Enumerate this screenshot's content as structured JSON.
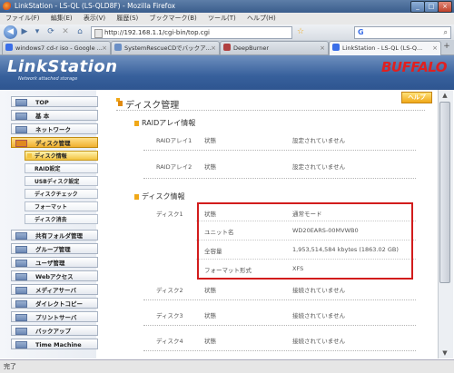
{
  "window": {
    "title": "LinkStation - LS-QL (LS-QLD8F) - Mozilla Firefox"
  },
  "menu": [
    "ファイル(F)",
    "編集(E)",
    "表示(V)",
    "履歴(S)",
    "ブックマーク(B)",
    "ツール(T)",
    "ヘルプ(H)"
  ],
  "address": {
    "url": "http://192.168.1.1/cgi-bin/top.cgi"
  },
  "tabs": [
    {
      "label": "windows7 cd-r iso - Google ...",
      "color": "#3a6ee8"
    },
    {
      "label": "SystemRescueCDでバックア...",
      "color": "#6a8fc6"
    },
    {
      "label": "DeepBurner",
      "color": "#b04040"
    },
    {
      "label": "LinkStation - LS-QL (LS-Q...",
      "color": "#3a6ee8"
    }
  ],
  "header": {
    "logo": "LinkStation",
    "logo_sub": "Network attached storage",
    "brand": "BUFFALO",
    "brand_color": "#e02020"
  },
  "sidebar": {
    "items": [
      {
        "label": "TOP"
      },
      {
        "label": "基 本"
      },
      {
        "label": "ネットワーク"
      },
      {
        "label": "ディスク管理"
      },
      {
        "label": "共有フォルダ管理"
      },
      {
        "label": "グループ管理"
      },
      {
        "label": "ユーザ管理"
      },
      {
        "label": "Webアクセス"
      },
      {
        "label": "メディアサーバ"
      },
      {
        "label": "ダイレクトコピー"
      },
      {
        "label": "プリントサーバ"
      },
      {
        "label": "バックアップ"
      },
      {
        "label": "Time Machine"
      }
    ],
    "subitems": [
      {
        "label": "ディスク情報"
      },
      {
        "label": "RAID設定"
      },
      {
        "label": "USBディスク設定"
      },
      {
        "label": "ディスクチェック"
      },
      {
        "label": "フォーマット"
      },
      {
        "label": "ディスク消去"
      }
    ]
  },
  "main": {
    "title": "ディスク管理",
    "help": "ヘルプ",
    "raid_title": "RAIDアレイ情報",
    "raid_rows": [
      {
        "name": "RAIDアレイ1",
        "key": "状態",
        "value": "設定されていません"
      },
      {
        "name": "RAIDアレイ2",
        "key": "状態",
        "value": "設定されていません"
      }
    ],
    "disk_title": "ディスク情報",
    "disk1": {
      "name": "ディスク1",
      "rows": [
        {
          "key": "状態",
          "value": "通常モード"
        },
        {
          "key": "ユニット名",
          "value": "WD20EARS-00MVWB0"
        },
        {
          "key": "全容量",
          "value": "1,953,514,584 kbytes (1863.02 GB)"
        },
        {
          "key": "フォーマット形式",
          "value": "XFS"
        }
      ]
    },
    "other_disks": [
      {
        "name": "ディスク2",
        "key": "状態",
        "value": "接続されていません"
      },
      {
        "name": "ディスク3",
        "key": "状態",
        "value": "接続されていません"
      },
      {
        "name": "ディスク4",
        "key": "状態",
        "value": "接続されていません"
      }
    ]
  },
  "status": {
    "text": "完了"
  },
  "colors": {
    "highlight": "#d21c1c",
    "accent": "#f0a818"
  }
}
